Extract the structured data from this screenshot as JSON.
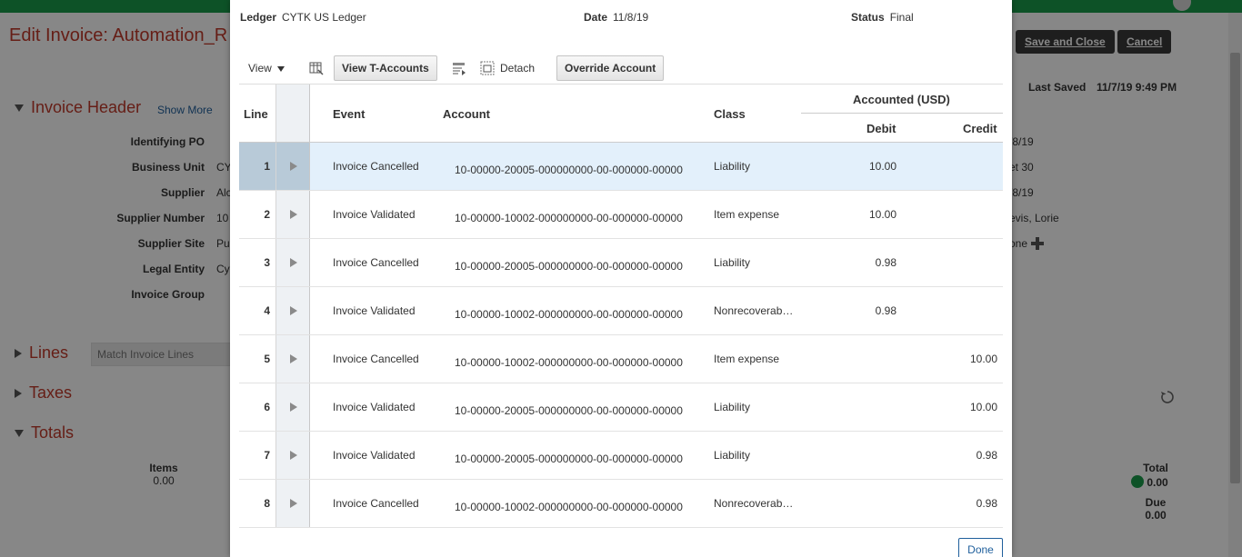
{
  "background": {
    "page_title": "Edit Invoice: Automation_R",
    "save_close_label": "Save and Close",
    "cancel_label": "Cancel",
    "last_saved_label": "Last Saved",
    "last_saved_value": "11/7/19 9:49 PM",
    "invoice_header_title": "Invoice Header",
    "show_more_label": "Show More",
    "fields": [
      {
        "label": "Identifying PO",
        "value": ""
      },
      {
        "label": "Business Unit",
        "value": "CY"
      },
      {
        "label": "Supplier",
        "value": "Alc"
      },
      {
        "label": "Supplier Number",
        "value": "10"
      },
      {
        "label": "Supplier Site",
        "value": "Pu"
      },
      {
        "label": "Legal Entity",
        "value": "Cy"
      },
      {
        "label": "Invoice Group",
        "value": ""
      }
    ],
    "right_values": [
      "/8/19",
      "et 30",
      "/8/19",
      "evis, Lorie",
      "one"
    ],
    "lines_title": "Lines",
    "match_lines_placeholder": "Match Invoice Lines",
    "taxes_title": "Taxes",
    "totals_title": "Totals",
    "items_label": "Items",
    "items_value": "0.00",
    "total_label": "Total",
    "total_value": "0.00",
    "due_label": "Due",
    "due_value": "0.00"
  },
  "dialog": {
    "ledger_label": "Ledger",
    "ledger_value": "CYTK US Ledger",
    "date_label": "Date",
    "date_value": "11/8/19",
    "status_label": "Status",
    "status_value": "Final",
    "toolbar": {
      "view_label": "View",
      "view_t_accounts_label": "View T-Accounts",
      "detach_label": "Detach",
      "override_account_label": "Override Account"
    },
    "columns": {
      "line": "Line",
      "event": "Event",
      "account": "Account",
      "class": "Class",
      "accounted": "Accounted (USD)",
      "debit": "Debit",
      "credit": "Credit"
    },
    "rows": [
      {
        "line": "1",
        "event": "Invoice Cancelled",
        "account": "10-00000-20005-000000000-00-000000-00000",
        "class": "Liability",
        "debit": "10.00",
        "credit": ""
      },
      {
        "line": "2",
        "event": "Invoice Validated",
        "account": "10-00000-10002-000000000-00-000000-00000",
        "class": "Item expense",
        "debit": "10.00",
        "credit": ""
      },
      {
        "line": "3",
        "event": "Invoice Cancelled",
        "account": "10-00000-20005-000000000-00-000000-00000",
        "class": "Liability",
        "debit": "0.98",
        "credit": ""
      },
      {
        "line": "4",
        "event": "Invoice Validated",
        "account": "10-00000-10002-000000000-00-000000-00000",
        "class": "Nonrecoverab…",
        "debit": "0.98",
        "credit": ""
      },
      {
        "line": "5",
        "event": "Invoice Cancelled",
        "account": "10-00000-10002-000000000-00-000000-00000",
        "class": "Item expense",
        "debit": "",
        "credit": "10.00"
      },
      {
        "line": "6",
        "event": "Invoice Validated",
        "account": "10-00000-20005-000000000-00-000000-00000",
        "class": "Liability",
        "debit": "",
        "credit": "10.00"
      },
      {
        "line": "7",
        "event": "Invoice Validated",
        "account": "10-00000-20005-000000000-00-000000-00000",
        "class": "Liability",
        "debit": "",
        "credit": "0.98"
      },
      {
        "line": "8",
        "event": "Invoice Cancelled",
        "account": "10-00000-10002-000000000-00-000000-00000",
        "class": "Nonrecoverab…",
        "debit": "",
        "credit": "0.98"
      }
    ],
    "done_label": "Done"
  },
  "colors": {
    "brand_green": "#1a9b4b",
    "title_red": "#c0392b",
    "link_blue": "#1f5f9c",
    "selected_row": "#e3f0fb"
  }
}
